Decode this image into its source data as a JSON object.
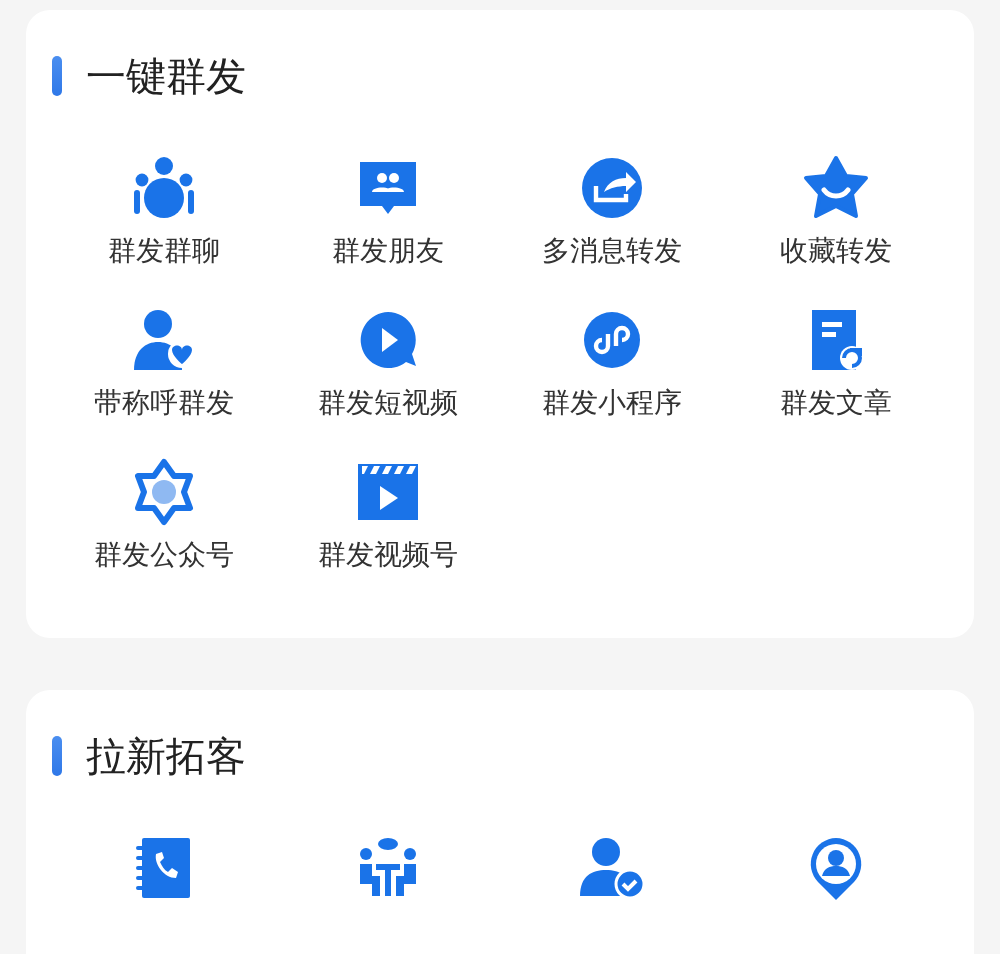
{
  "sections": [
    {
      "title": "一键群发",
      "items": [
        {
          "label": "群发群聊"
        },
        {
          "label": "群发朋友"
        },
        {
          "label": "多消息转发"
        },
        {
          "label": "收藏转发"
        },
        {
          "label": "带称呼群发"
        },
        {
          "label": "群发短视频"
        },
        {
          "label": "群发小程序"
        },
        {
          "label": "群发文章"
        },
        {
          "label": "群发公众号"
        },
        {
          "label": "群发视频号"
        }
      ]
    },
    {
      "title": "拉新拓客",
      "items": [
        {
          "kind": "icon"
        },
        {
          "kind": "icon"
        },
        {
          "kind": "icon"
        },
        {
          "kind": "icon"
        }
      ]
    }
  ]
}
